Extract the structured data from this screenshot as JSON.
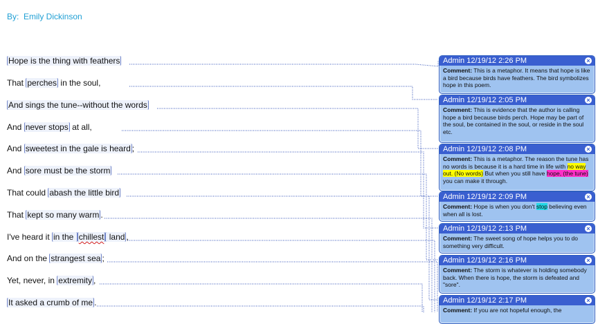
{
  "document": {
    "byline": "By:  Emily Dickinson",
    "lines": [
      {
        "segments": [
          {
            "text": "Hope is the thing with feathers",
            "anchored": true
          }
        ]
      },
      {
        "segments": [
          {
            "text": "That "
          },
          {
            "text": "perches",
            "anchored": true
          },
          {
            "text": " in the soul,"
          }
        ]
      },
      {
        "segments": [
          {
            "text": "And sings the tune--without the words",
            "anchored": true
          }
        ]
      },
      {
        "segments": [
          {
            "text": "And "
          },
          {
            "text": "never stops",
            "anchored": true
          },
          {
            "text": " at all,"
          }
        ]
      },
      {
        "segments": [
          {
            "text": "And "
          },
          {
            "text": "sweetest in the gale is heard",
            "anchored": true
          },
          {
            "text": ";"
          }
        ]
      },
      {
        "segments": [
          {
            "text": "And "
          },
          {
            "text": "sore must be the storm",
            "anchored": true
          }
        ]
      },
      {
        "segments": [
          {
            "text": "That could "
          },
          {
            "text": "abash the little bird",
            "anchored": true
          }
        ]
      },
      {
        "segments": [
          {
            "text": "That "
          },
          {
            "text": "kept so many warm",
            "anchored": true
          },
          {
            "text": "."
          }
        ]
      },
      {
        "segments": [
          {
            "text": "I've heard it "
          },
          {
            "text": "in the ",
            "anchored": true
          },
          {
            "text": "chillest",
            "anchored": true,
            "misspelled": true
          },
          {
            "text": " land",
            "anchored": true
          },
          {
            "text": ","
          }
        ]
      },
      {
        "segments": [
          {
            "text": "And on the "
          },
          {
            "text": "strangest sea",
            "anchored": true
          },
          {
            "text": ";"
          }
        ]
      },
      {
        "segments": [
          {
            "text": "Yet, never, in "
          },
          {
            "text": "extremity",
            "anchored": true
          },
          {
            "text": ","
          }
        ]
      },
      {
        "segments": [
          {
            "text": "It asked a crumb of me",
            "anchored": true
          },
          {
            "text": "."
          }
        ]
      }
    ]
  },
  "comments": [
    {
      "header": "Admin 12/19/12 2:26 PM",
      "label": "Comment:",
      "segments": [
        {
          "text": " This is a metaphor. It means that hope is like a bird because birds have feathers. The bird symbolizes hope in this poem."
        }
      ]
    },
    {
      "header": "Admin 12/19/12 2:05 PM",
      "label": "Comment:",
      "segments": [
        {
          "text": " This is evidence that the author is calling hope a bird because birds perch. Hope may be part of the soul, be contained in the soul, or reside in the soul etc."
        }
      ]
    },
    {
      "header": "Admin 12/19/12 2:08 PM",
      "label": "Comment:",
      "segments": [
        {
          "text": " This is a metaphor. The reason the tune has no words is because it is a hard time in life with "
        },
        {
          "text": "no way out. (No words)",
          "highlight": "#ffff00"
        },
        {
          "text": " But when you still have "
        },
        {
          "text": "hope, (the tune)",
          "highlight": "#ff2fc8"
        },
        {
          "text": " you can make it through."
        }
      ]
    },
    {
      "header": "Admin 12/19/12 2:09 PM",
      "label": "Comment:",
      "segments": [
        {
          "text": " Hope is when you don't "
        },
        {
          "text": "stop",
          "highlight": "#22d9e6"
        },
        {
          "text": " believing even when all is lost."
        }
      ]
    },
    {
      "header": "Admin 12/19/12 2:13 PM",
      "label": "Comment:",
      "segments": [
        {
          "text": " The sweet song of hope helps you to do something very difficult."
        }
      ]
    },
    {
      "header": "Admin 12/19/12 2:16 PM",
      "label": "Comment:",
      "segments": [
        {
          "text": " The storm is whatever is holding somebody back. When there is hope, the storm is defeated and \"sore\"."
        }
      ]
    },
    {
      "header": "Admin 12/19/12 2:17 PM",
      "label": "Comment:",
      "segments": [
        {
          "text": " If you are not hopeful enough, the"
        }
      ]
    }
  ],
  "icons": {
    "close": "close-icon"
  },
  "colors": {
    "byline": "#1f9fd4",
    "comment_header": "#3a5fd0",
    "comment_body": "#9fc3f0",
    "connector": "#3050b8"
  }
}
